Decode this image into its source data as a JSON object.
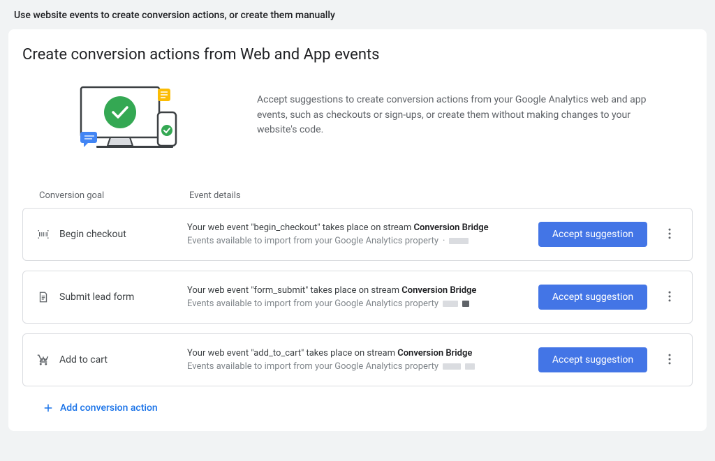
{
  "page_header": "Use website events to create conversion actions, or create them manually",
  "card": {
    "title": "Create conversion actions from Web and App events",
    "hero_text": "Accept suggestions to create conversion actions from your Google Analytics web and app events, such as checkouts or sign-ups, or create them without making changes to your website's code."
  },
  "table": {
    "col_goal": "Conversion goal",
    "col_details": "Event details"
  },
  "suggestions": [
    {
      "goal_label": "Begin checkout",
      "event_name": "begin_checkout",
      "stream_name": "Conversion Bridge",
      "sub_prefix": "Events available to import from your Google Analytics property"
    },
    {
      "goal_label": "Submit lead form",
      "event_name": "form_submit",
      "stream_name": "Conversion Bridge",
      "sub_prefix": "Events available to import from your Google Analytics property"
    },
    {
      "goal_label": "Add to cart",
      "event_name": "add_to_cart",
      "stream_name": "Conversion Bridge",
      "sub_prefix": "Events available to import from your Google Analytics property"
    }
  ],
  "buttons": {
    "accept": "Accept suggestion",
    "add_action": "Add conversion action"
  }
}
